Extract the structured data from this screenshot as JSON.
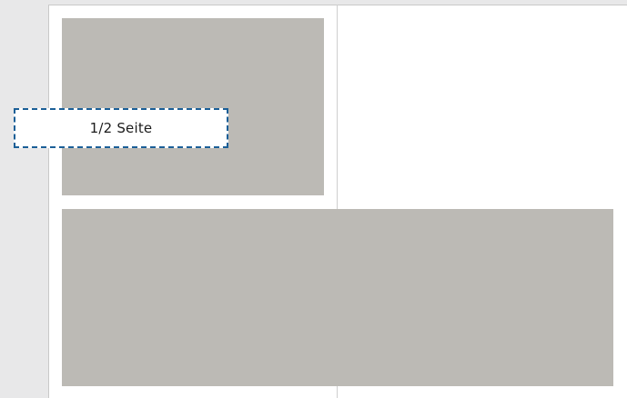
{
  "layout_label": "1/2 Seite",
  "colors": {
    "background": "#e8e8e9",
    "page": "#ffffff",
    "placeholder_block": "#bcbab5",
    "dashed_border": "#1b5f97",
    "fold_line": "#cfcfcf"
  }
}
